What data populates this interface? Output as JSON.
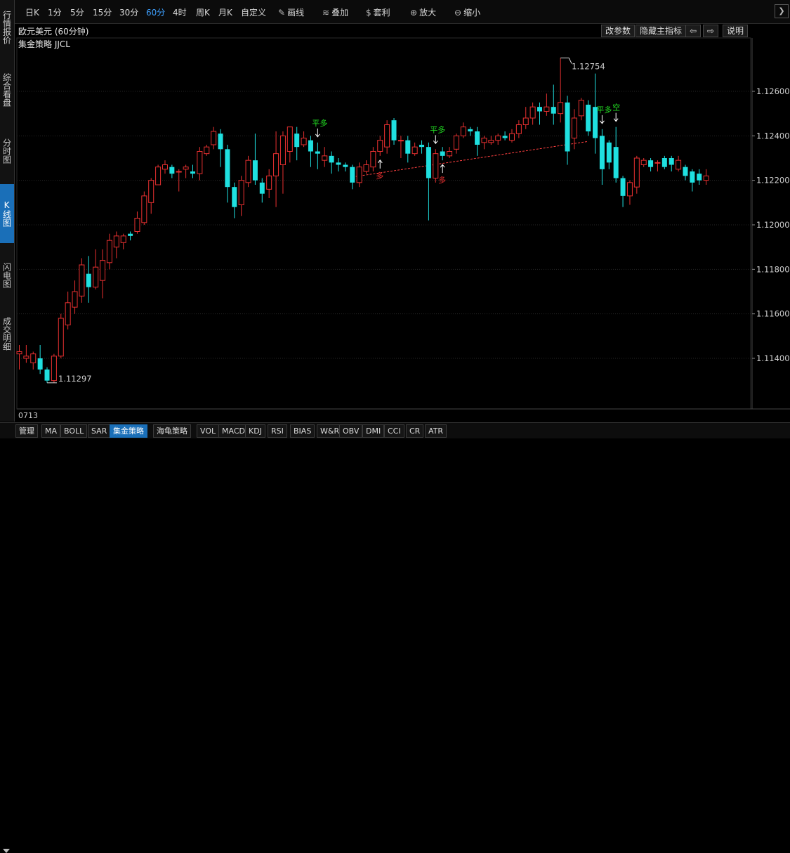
{
  "left_tabs": [
    {
      "label": "行情报价",
      "active": false
    },
    {
      "label": "综合看盘",
      "active": false
    },
    {
      "label": "分时图",
      "active": false
    },
    {
      "label": "K线图",
      "active": true
    },
    {
      "label": "闪电图",
      "active": false
    },
    {
      "label": "成交明细",
      "active": false
    }
  ],
  "toolbar": {
    "periods": [
      "日K",
      "1分",
      "5分",
      "15分",
      "30分",
      "60分",
      "4时",
      "周K",
      "月K",
      "自定义"
    ],
    "active_period": "60分",
    "tools": [
      {
        "label": "画线",
        "icon": "pencil-icon",
        "glyph": "✎"
      },
      {
        "label": "叠加",
        "icon": "layers-icon",
        "glyph": "≋"
      },
      {
        "label": "套利",
        "icon": "moneybag-icon",
        "glyph": "$"
      },
      {
        "label": "放大",
        "icon": "zoom-in-icon",
        "glyph": "⊕"
      },
      {
        "label": "缩小",
        "icon": "zoom-out-icon",
        "glyph": "⊖"
      }
    ],
    "scroll_glyph": "❯"
  },
  "chart_header": {
    "title": "欧元美元 (60分钟)",
    "buttons": [
      {
        "label": "改参数"
      },
      {
        "label": "隐藏主指标"
      },
      {
        "label": "⇦"
      },
      {
        "label": "⇨"
      },
      {
        "label": "说明"
      }
    ],
    "indicator_label": "集金策略 JJCL"
  },
  "x_axis_label": "0713",
  "bottom_tabs": [
    "管理",
    "MA",
    "BOLL",
    "SAR",
    "集金策略",
    "海龟策略",
    "VOL",
    "MACD",
    "KDJ",
    "RSI",
    "BIAS",
    "W&R",
    "OBV",
    "DMI",
    "CCI",
    "CR",
    "ATR"
  ],
  "active_bottom_tab": "集金策略",
  "colors": {
    "up": "#e83030",
    "down": "#1fe0e0",
    "signal_flat": "#22dd22",
    "signal_long": "#e83030",
    "signal_short": "#22dd22",
    "ma_line": "#ff4040"
  },
  "chart_data": {
    "type": "candlestick",
    "title": "欧元美元 (60分钟)",
    "ylim": [
      1.1125,
      1.1275
    ],
    "y_ticks": [
      "1.12600",
      "1.12400",
      "1.12200",
      "1.12000",
      "1.11800",
      "1.11600",
      "1.11400"
    ],
    "high_marker": "1.12754",
    "low_marker": "1.11297",
    "candles": [
      [
        1.1142,
        1.1143,
        1.1135,
        1.1146
      ],
      [
        1.114,
        1.1141,
        1.1138,
        1.1146
      ],
      [
        1.1138,
        1.1142,
        1.1135,
        1.1143
      ],
      [
        1.114,
        1.1135,
        1.1133,
        1.1146
      ],
      [
        1.1135,
        1.113,
        1.1129,
        1.1136
      ],
      [
        1.113,
        1.1141,
        1.1129,
        1.1142
      ],
      [
        1.1141,
        1.1158,
        1.114,
        1.116
      ],
      [
        1.1155,
        1.1165,
        1.1153,
        1.117
      ],
      [
        1.1163,
        1.117,
        1.116,
        1.1175
      ],
      [
        1.1168,
        1.1182,
        1.1165,
        1.1185
      ],
      [
        1.1178,
        1.1172,
        1.1165,
        1.1186
      ],
      [
        1.1172,
        1.1181,
        1.1171,
        1.1189
      ],
      [
        1.1175,
        1.1184,
        1.1167,
        1.1189
      ],
      [
        1.1183,
        1.1193,
        1.118,
        1.1196
      ],
      [
        1.119,
        1.1195,
        1.1185,
        1.1197
      ],
      [
        1.1192,
        1.1195,
        1.1189,
        1.1196
      ],
      [
        1.1196,
        1.1195,
        1.1193,
        1.1197
      ],
      [
        1.1197,
        1.1203,
        1.1196,
        1.1206
      ],
      [
        1.1201,
        1.1213,
        1.12,
        1.1215
      ],
      [
        1.121,
        1.122,
        1.1205,
        1.1221
      ],
      [
        1.1218,
        1.1226,
        1.1218,
        1.1227
      ],
      [
        1.1225,
        1.1227,
        1.1223,
        1.1229
      ],
      [
        1.1226,
        1.1223,
        1.1221,
        1.1227
      ],
      [
        1.1224,
        1.1224,
        1.1215,
        1.1225
      ],
      [
        1.1225,
        1.1226,
        1.1221,
        1.1227
      ],
      [
        1.1224,
        1.1223,
        1.1221,
        1.1227
      ],
      [
        1.1223,
        1.1233,
        1.122,
        1.1235
      ],
      [
        1.1232,
        1.1235,
        1.1231,
        1.1236
      ],
      [
        1.1236,
        1.1242,
        1.1234,
        1.1244
      ],
      [
        1.1241,
        1.1234,
        1.1226,
        1.1243
      ],
      [
        1.1234,
        1.1217,
        1.121,
        1.1236
      ],
      [
        1.1217,
        1.1208,
        1.1203,
        1.1219
      ],
      [
        1.1209,
        1.122,
        1.1204,
        1.1222
      ],
      [
        1.1219,
        1.1229,
        1.1217,
        1.1231
      ],
      [
        1.1229,
        1.122,
        1.1218,
        1.1241
      ],
      [
        1.1219,
        1.1214,
        1.121,
        1.1221
      ],
      [
        1.1216,
        1.1222,
        1.1212,
        1.1225
      ],
      [
        1.1222,
        1.1232,
        1.1208,
        1.1242
      ],
      [
        1.1227,
        1.124,
        1.1214,
        1.1242
      ],
      [
        1.1233,
        1.1244,
        1.1228,
        1.1244
      ],
      [
        1.1241,
        1.1235,
        1.1229,
        1.1244
      ],
      [
        1.1236,
        1.1239,
        1.1235,
        1.1242
      ],
      [
        1.1238,
        1.1233,
        1.1226,
        1.124
      ],
      [
        1.1233,
        1.1232,
        1.1225,
        1.1237
      ],
      [
        1.1229,
        1.1231,
        1.1226,
        1.1235
      ],
      [
        1.1231,
        1.1228,
        1.1223,
        1.1233
      ],
      [
        1.1228,
        1.1227,
        1.1224,
        1.123
      ],
      [
        1.1227,
        1.1226,
        1.1224,
        1.1228
      ],
      [
        1.1226,
        1.1219,
        1.1216,
        1.1227
      ],
      [
        1.1219,
        1.1226,
        1.1217,
        1.1228
      ],
      [
        1.1224,
        1.1227,
        1.1223,
        1.1229
      ],
      [
        1.1226,
        1.1233,
        1.1224,
        1.1235
      ],
      [
        1.1233,
        1.1238,
        1.1231,
        1.124
      ],
      [
        1.1235,
        1.1245,
        1.1232,
        1.1247
      ],
      [
        1.1247,
        1.1238,
        1.1236,
        1.1248
      ],
      [
        1.1238,
        1.1238,
        1.123,
        1.124
      ],
      [
        1.1238,
        1.1232,
        1.1228,
        1.124
      ],
      [
        1.1232,
        1.1235,
        1.1231,
        1.1237
      ],
      [
        1.1236,
        1.1235,
        1.1232,
        1.1238
      ],
      [
        1.1235,
        1.1221,
        1.1202,
        1.1237
      ],
      [
        1.1221,
        1.1232,
        1.1219,
        1.1234
      ],
      [
        1.1233,
        1.1231,
        1.1229,
        1.1235
      ],
      [
        1.1231,
        1.1233,
        1.123,
        1.1235
      ],
      [
        1.1234,
        1.124,
        1.1232,
        1.1241
      ],
      [
        1.124,
        1.1244,
        1.1239,
        1.1246
      ],
      [
        1.1243,
        1.1242,
        1.124,
        1.1244
      ],
      [
        1.1242,
        1.1236,
        1.1231,
        1.1244
      ],
      [
        1.1237,
        1.1239,
        1.1234,
        1.124
      ],
      [
        1.1237,
        1.1238,
        1.1236,
        1.124
      ],
      [
        1.1238,
        1.124,
        1.1236,
        1.1241
      ],
      [
        1.124,
        1.1239,
        1.1238,
        1.1242
      ],
      [
        1.1238,
        1.1241,
        1.1237,
        1.1243
      ],
      [
        1.1241,
        1.1245,
        1.1239,
        1.1247
      ],
      [
        1.1245,
        1.1248,
        1.1243,
        1.1253
      ],
      [
        1.1248,
        1.1253,
        1.1245,
        1.1255
      ],
      [
        1.1253,
        1.1251,
        1.1245,
        1.1255
      ],
      [
        1.1251,
        1.1253,
        1.1249,
        1.1259
      ],
      [
        1.1253,
        1.125,
        1.1245,
        1.1263
      ],
      [
        1.125,
        1.1255,
        1.1246,
        1.1275
      ],
      [
        1.1255,
        1.1233,
        1.1227,
        1.1258
      ],
      [
        1.1239,
        1.1248,
        1.1234,
        1.1252
      ],
      [
        1.1249,
        1.1256,
        1.1247,
        1.1257
      ],
      [
        1.1254,
        1.1242,
        1.124,
        1.1256
      ],
      [
        1.1253,
        1.1239,
        1.1232,
        1.1268
      ],
      [
        1.124,
        1.1225,
        1.1218,
        1.1243
      ],
      [
        1.1237,
        1.1228,
        1.1225,
        1.1238
      ],
      [
        1.1235,
        1.1221,
        1.1219,
        1.1244
      ],
      [
        1.1221,
        1.1213,
        1.1208,
        1.1222
      ],
      [
        1.1213,
        1.1219,
        1.1209,
        1.122
      ],
      [
        1.1217,
        1.123,
        1.1214,
        1.1231
      ],
      [
        1.1227,
        1.1229,
        1.1226,
        1.123
      ],
      [
        1.1229,
        1.1226,
        1.1224,
        1.123
      ],
      [
        1.1228,
        1.1228,
        1.1224,
        1.1229
      ],
      [
        1.123,
        1.1226,
        1.1225,
        1.1231
      ],
      [
        1.123,
        1.1227,
        1.1224,
        1.1231
      ],
      [
        1.1225,
        1.1229,
        1.1224,
        1.1231
      ],
      [
        1.1226,
        1.1222,
        1.122,
        1.1227
      ],
      [
        1.1224,
        1.1219,
        1.1215,
        1.1225
      ],
      [
        1.1223,
        1.122,
        1.1218,
        1.1225
      ],
      [
        1.122,
        1.1222,
        1.1218,
        1.1225
      ]
    ],
    "ma_line": {
      "start_index": 48,
      "start": 1.12215,
      "end_index": 82,
      "end": 1.12375
    },
    "signals": [
      {
        "index": 43,
        "label": "平多",
        "kind": "flat"
      },
      {
        "index": 52,
        "label": "多",
        "kind": "long"
      },
      {
        "index": 60,
        "label": "平多",
        "kind": "flat"
      },
      {
        "index": 61,
        "label": "多",
        "kind": "long"
      },
      {
        "index": 84,
        "label": "平多",
        "kind": "flat"
      },
      {
        "index": 86,
        "label": "空",
        "kind": "short"
      }
    ]
  }
}
